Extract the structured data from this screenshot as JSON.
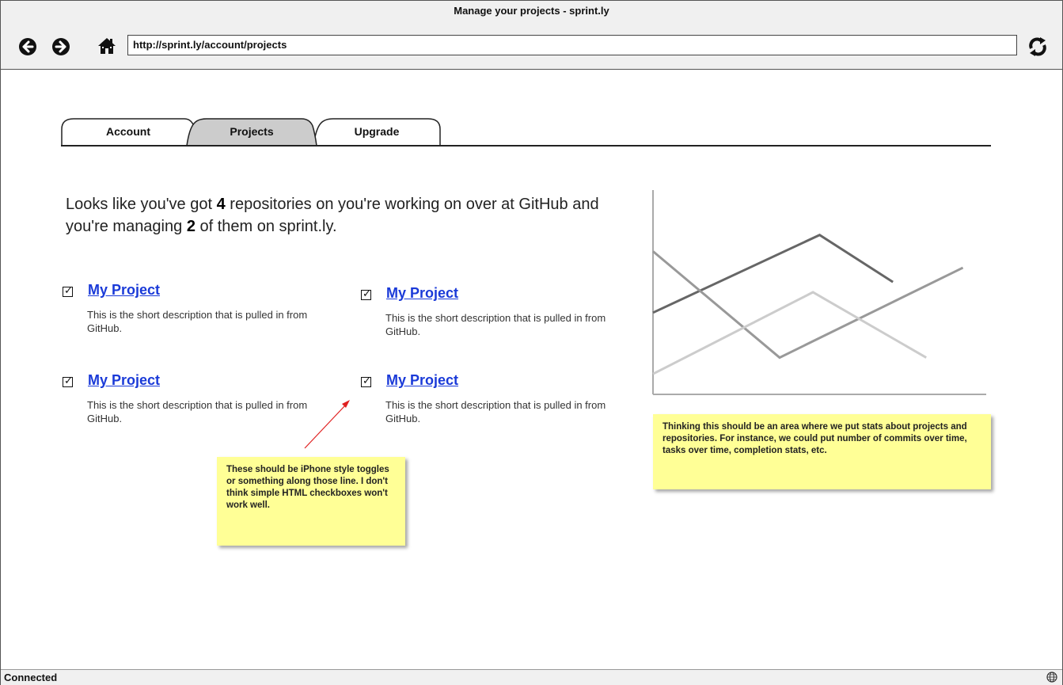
{
  "browser": {
    "title": "Manage your projects - sprint.ly",
    "url": "http://sprint.ly/account/projects",
    "status": "Connected"
  },
  "tabs": [
    {
      "label": "Account",
      "active": false
    },
    {
      "label": "Projects",
      "active": true
    },
    {
      "label": "Upgrade",
      "active": false
    }
  ],
  "intro": {
    "part1": "Looks like you've got ",
    "repo_count": "4",
    "part2": " repositories on you're working on over at GitHub and you're managing ",
    "managed_count": "2",
    "part3": " of them on sprint.ly."
  },
  "projects": [
    {
      "name": "My Project",
      "description": "This is the short description that is pulled in from GitHub.",
      "checked": true
    },
    {
      "name": "My Project",
      "description": "This is the short description that is pulled in from GitHub.",
      "checked": true
    },
    {
      "name": "My Project",
      "description": "This is the short description that is pulled in from GitHub.",
      "checked": true
    },
    {
      "name": "My Project",
      "description": "This is the short description that is pulled in from GitHub.",
      "checked": true
    }
  ],
  "notes": {
    "toggles": "These should be iPhone style toggles or something along those line. I don't think simple HTML checkboxes won't work well.",
    "stats": "Thinking this should be an area where we put stats about projects and repositories. For instance, we could put number of commits over time, tasks over time, completion stats, etc."
  },
  "chart_data": {
    "type": "line",
    "series": [
      {
        "color": "#666666",
        "points": [
          [
            0,
            40
          ],
          [
            50,
            78
          ],
          [
            72,
            55
          ]
        ]
      },
      {
        "color": "#999999",
        "points": [
          [
            0,
            70
          ],
          [
            38,
            18
          ],
          [
            93,
            62
          ]
        ]
      },
      {
        "color": "#cccccc",
        "points": [
          [
            0,
            10
          ],
          [
            48,
            50
          ],
          [
            82,
            18
          ]
        ]
      }
    ],
    "xlim": [
      0,
      100
    ],
    "ylim": [
      0,
      100
    ]
  },
  "colors": {
    "link": "#1a3ad8",
    "sticky": "#ffff96",
    "arrow": "#e02020"
  }
}
